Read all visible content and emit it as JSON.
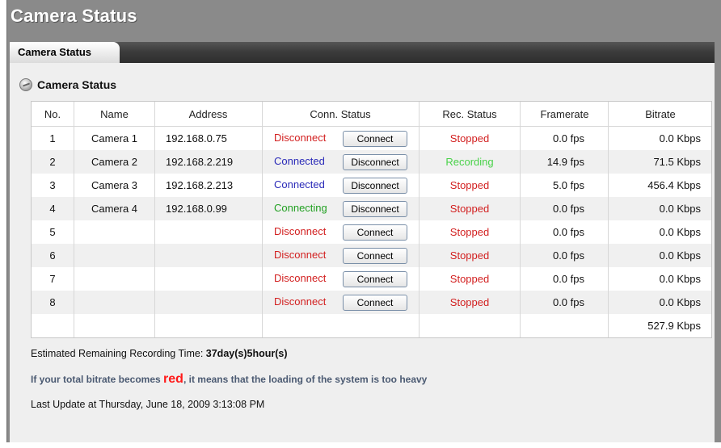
{
  "page": {
    "title": "Camera Status"
  },
  "tabs": [
    {
      "label": "Camera Status",
      "active": true
    }
  ],
  "section": {
    "title": "Camera Status",
    "icon": "globe-icon"
  },
  "table": {
    "headers": [
      "No.",
      "Name",
      "Address",
      "Conn. Status",
      "Rec. Status",
      "Framerate",
      "Bitrate"
    ],
    "rows": [
      {
        "no": "1",
        "name": "Camera 1",
        "address": "192.168.0.75",
        "conn_status": "Disconnect",
        "conn_color": "#d21f1f",
        "action": "Connect",
        "rec_status": "Stopped",
        "rec_color": "#d21f1f",
        "framerate": "0.0 fps",
        "bitrate": "0.0 Kbps"
      },
      {
        "no": "2",
        "name": "Camera 2",
        "address": "192.168.2.219",
        "conn_status": "Connected",
        "conn_color": "#2a2ab8",
        "action": "Disconnect",
        "rec_status": "Recording",
        "rec_color": "#49d249",
        "framerate": "14.9 fps",
        "bitrate": "71.5 Kbps"
      },
      {
        "no": "3",
        "name": "Camera 3",
        "address": "192.168.2.213",
        "conn_status": "Connected",
        "conn_color": "#2a2ab8",
        "action": "Disconnect",
        "rec_status": "Stopped",
        "rec_color": "#d21f1f",
        "framerate": "5.0 fps",
        "bitrate": "456.4 Kbps"
      },
      {
        "no": "4",
        "name": "Camera 4",
        "address": "192.168.0.99",
        "conn_status": "Connecting",
        "conn_color": "#22a022",
        "action": "Disconnect",
        "rec_status": "Stopped",
        "rec_color": "#d21f1f",
        "framerate": "0.0 fps",
        "bitrate": "0.0 Kbps"
      },
      {
        "no": "5",
        "name": "",
        "address": "",
        "conn_status": "Disconnect",
        "conn_color": "#d21f1f",
        "action": "Connect",
        "rec_status": "Stopped",
        "rec_color": "#d21f1f",
        "framerate": "0.0 fps",
        "bitrate": "0.0 Kbps"
      },
      {
        "no": "6",
        "name": "",
        "address": "",
        "conn_status": "Disconnect",
        "conn_color": "#d21f1f",
        "action": "Connect",
        "rec_status": "Stopped",
        "rec_color": "#d21f1f",
        "framerate": "0.0 fps",
        "bitrate": "0.0 Kbps"
      },
      {
        "no": "7",
        "name": "",
        "address": "",
        "conn_status": "Disconnect",
        "conn_color": "#d21f1f",
        "action": "Connect",
        "rec_status": "Stopped",
        "rec_color": "#d21f1f",
        "framerate": "0.0 fps",
        "bitrate": "0.0 Kbps"
      },
      {
        "no": "8",
        "name": "",
        "address": "",
        "conn_status": "Disconnect",
        "conn_color": "#d21f1f",
        "action": "Connect",
        "rec_status": "Stopped",
        "rec_color": "#d21f1f",
        "framerate": "0.0 fps",
        "bitrate": "0.0 Kbps"
      }
    ],
    "total_bitrate": "527.9 Kbps"
  },
  "info": {
    "remaining_label": "Estimated Remaining Recording Time:",
    "remaining_value": "37day(s)5hour(s)",
    "warning_prefix": "If your total bitrate becomes",
    "warning_word": "red",
    "warning_suffix": ", it means that the loading of the system is too heavy",
    "last_update": "Last Update at Thursday, June 18, 2009 3:13:08 PM"
  }
}
